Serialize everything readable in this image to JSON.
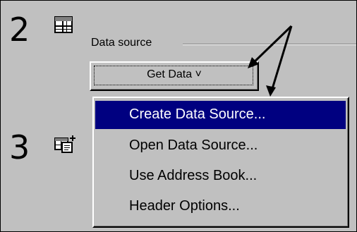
{
  "steps": [
    {
      "number": "2",
      "icon": "table-icon"
    },
    {
      "number": "3",
      "icon": "table-merge-icon"
    }
  ],
  "data_source": {
    "group_label": "Data source",
    "button_label": "Get Data ˅"
  },
  "menu": {
    "items": [
      {
        "label": "Create Data Source...",
        "selected": true
      },
      {
        "label": "Open Data Source...",
        "selected": false
      },
      {
        "label": "Use Address Book...",
        "selected": false
      },
      {
        "label": "Header Options...",
        "selected": false
      }
    ]
  },
  "colors": {
    "face": "#c0c0c0",
    "highlight": "#000080",
    "highlight_text": "#ffffff"
  }
}
